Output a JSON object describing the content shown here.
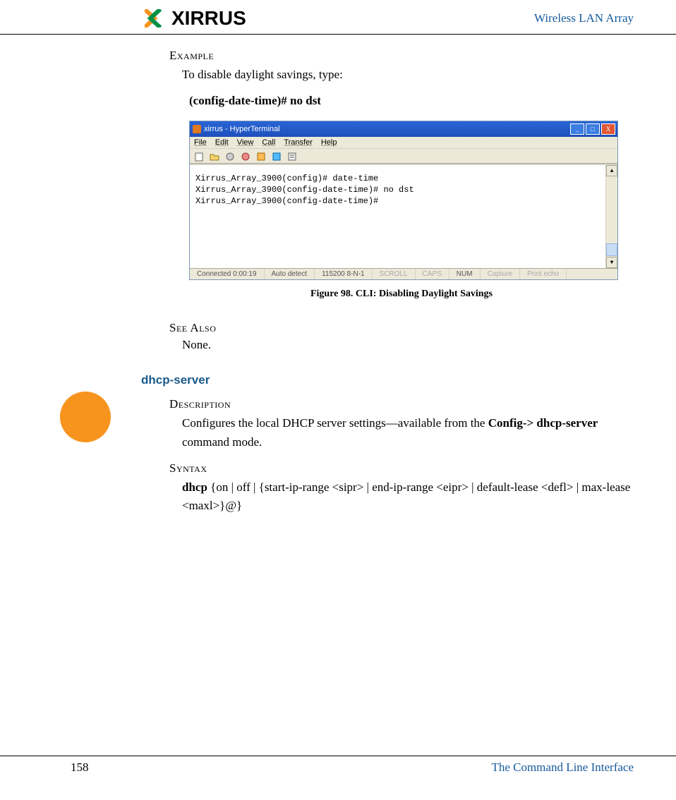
{
  "header": {
    "logo_text": "XIRRUS",
    "right_text": "Wireless LAN Array"
  },
  "example": {
    "label": "Example",
    "intro": "To disable daylight savings, type:",
    "command": "(config-date-time)# no dst"
  },
  "terminal": {
    "title": "xirrus - HyperTerminal",
    "menu": {
      "file": "File",
      "edit": "Edit",
      "view": "View",
      "call": "Call",
      "transfer": "Transfer",
      "help": "Help"
    },
    "lines": [
      "Xirrus_Array_3900(config)# date-time",
      "Xirrus_Array_3900(config-date-time)# no dst",
      "Xirrus_Array_3900(config-date-time)#"
    ],
    "status": {
      "connected": "Connected 0:00:19",
      "detect": "Auto detect",
      "baud": "115200 8-N-1",
      "scroll": "SCROLL",
      "caps": "CAPS",
      "num": "NUM",
      "capture": "Capture",
      "print": "Print echo"
    },
    "icons": {
      "minimize": "minimize-icon",
      "maximize": "maximize-icon",
      "close": "close-icon"
    }
  },
  "figure_caption": "Figure 98. CLI: Disabling Daylight Savings",
  "see_also": {
    "label": "See Also",
    "body": "None."
  },
  "dhcp": {
    "title": "dhcp-server",
    "description_label": "Description",
    "description_body_pre": "Configures the local DHCP server settings—available from the ",
    "description_body_bold": "Config-> dhcp-server",
    "description_body_post": "  command mode.",
    "syntax_label": "Syntax",
    "syntax_bold": "dhcp",
    "syntax_body": " {on | off | {start-ip-range <sipr> | end-ip-range <eipr> | default-lease <defl> | max-lease <maxl>}@}"
  },
  "footer": {
    "page_number": "158",
    "section_title": "The Command Line Interface"
  }
}
